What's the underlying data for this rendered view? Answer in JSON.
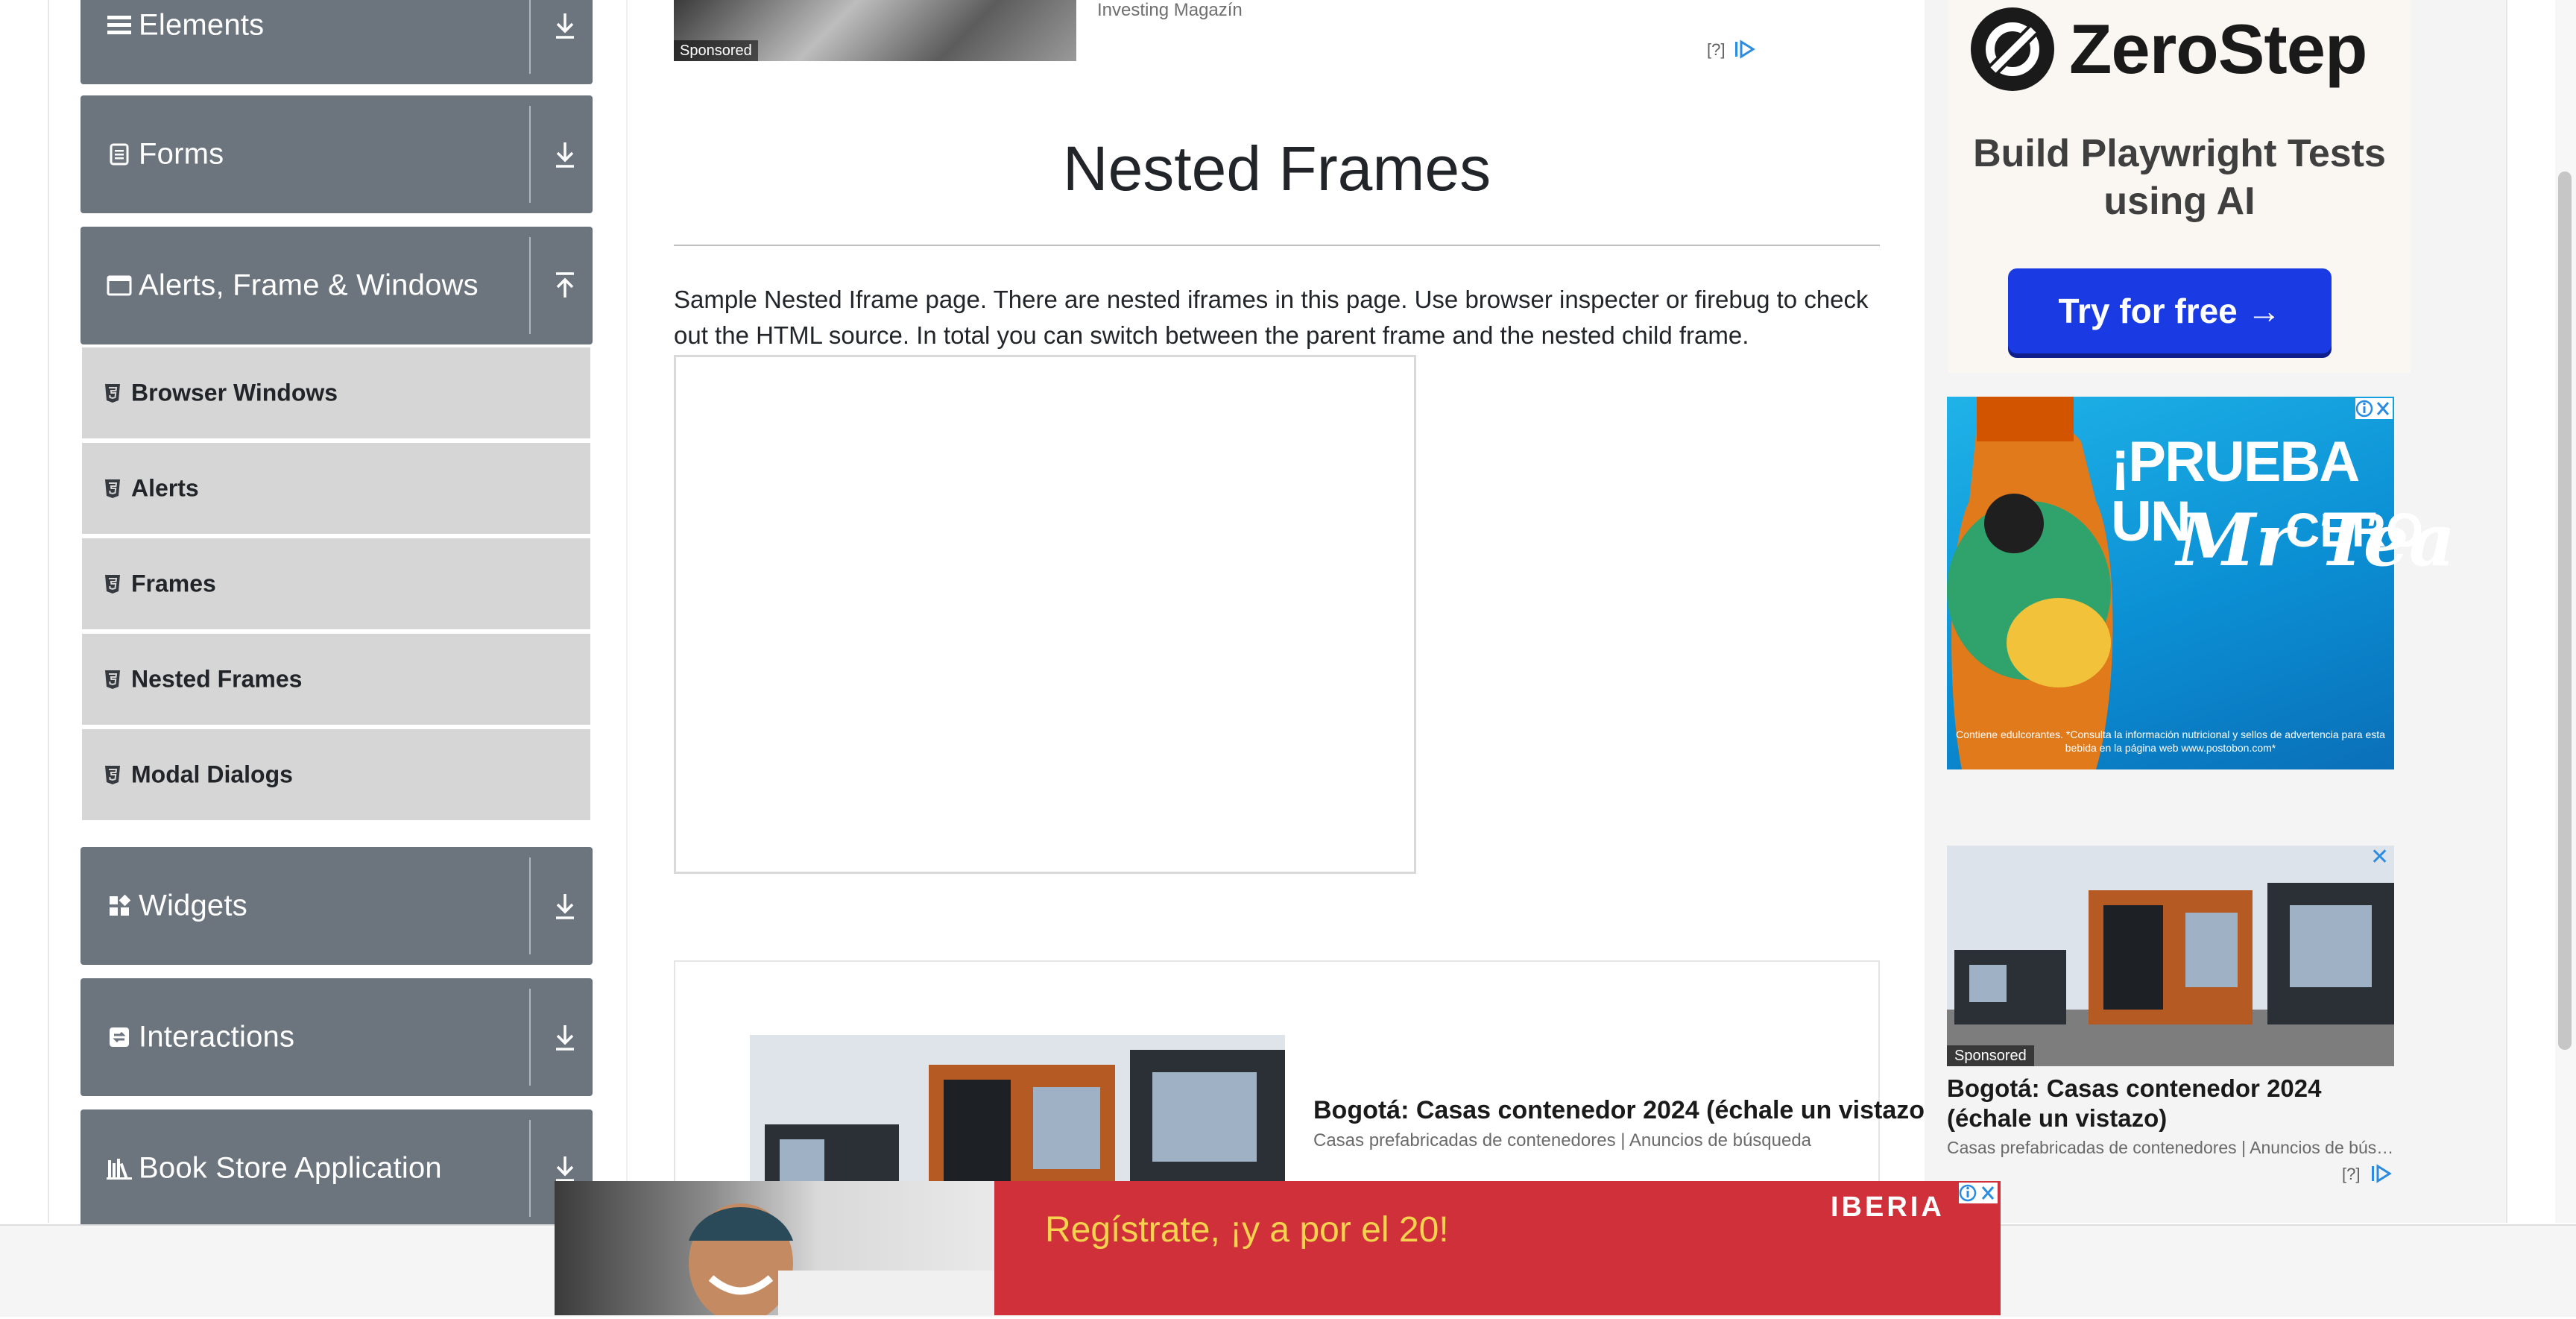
{
  "sidebar": {
    "groups_top": [
      {
        "label": "Elements"
      },
      {
        "label": "Forms"
      },
      {
        "label": "Alerts, Frame & Windows"
      }
    ],
    "items": [
      {
        "label": "Browser Windows"
      },
      {
        "label": "Alerts"
      },
      {
        "label": "Frames"
      },
      {
        "label": "Nested Frames"
      },
      {
        "label": "Modal Dialogs"
      }
    ],
    "groups_bottom": [
      {
        "label": "Widgets"
      },
      {
        "label": "Interactions"
      },
      {
        "label": "Book Store Application"
      }
    ]
  },
  "top_ad": {
    "sponsored": "Sponsored",
    "source": "Investing Magazín",
    "help": "[?]"
  },
  "main": {
    "title": "Nested Frames",
    "description": "Sample Nested Iframe page. There are nested iframes in this page. Use browser inspecter or firebug to check out the HTML source. In total you can switch between the parent frame and the nested child frame."
  },
  "inline_ad": {
    "title": "Bogotá: Casas contenedor 2024 (échale un vistazo)",
    "subtitle": "Casas prefabricadas de contenedores | Anuncios de búsqueda"
  },
  "zerostep_ad": {
    "brand": "ZeroStep",
    "tagline": "Build Playwright Tests using AI",
    "cta": "Try for free →"
  },
  "tea_ad": {
    "headline": "¡PRUEBA UN",
    "brand": "Mr Tea",
    "variant": "CERO",
    "fine_print": "Contiene edulcorantes. *Consulta la información nutricional y sellos de advertencia para esta bebida en la página web www.postobon.com*"
  },
  "side_ad": {
    "sponsored": "Sponsored",
    "close": "✕",
    "title": "Bogotá: Casas contenedor 2024 (échale un vistazo)",
    "subtitle": "Casas prefabricadas de contenedores | Anuncios de búsqueda",
    "help": "[?]"
  },
  "banner_ad": {
    "slogan": "Regístrate, ¡y a por el 20!",
    "brand": "IBERIA"
  },
  "colors": {
    "sidebar_group_bg": "#6c757d",
    "sidebar_item_bg": "#d6d6d6",
    "cta_blue": "#1a3be3",
    "banner_red": "#d0303a"
  }
}
